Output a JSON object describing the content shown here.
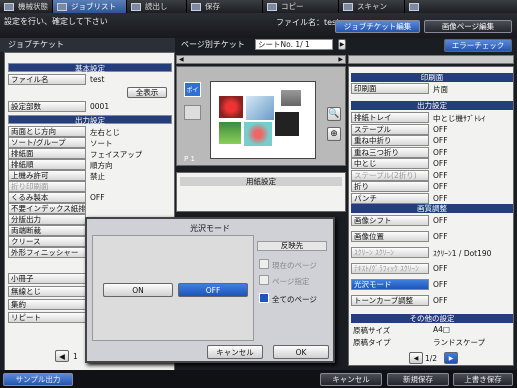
{
  "topbar": {
    "items": [
      {
        "label": "機械状態"
      },
      {
        "label": "ジョブリスト"
      },
      {
        "label": "読出し"
      },
      {
        "label": "保存"
      },
      {
        "label": "コピー"
      },
      {
        "label": "スキャン"
      }
    ]
  },
  "message": "設定を行い、確定して下さい",
  "filename": "ファイル名：test",
  "tabs": {
    "job_ticket_edit": "ジョブチケット編集",
    "page_edit": "画像ページ編集"
  },
  "left": {
    "title": "ジョブチケット",
    "sec_basic": "基本設定",
    "filename_btn": "ファイル名",
    "filename_val": "test",
    "show_all": "全表示",
    "copies_btn": "設定部数",
    "copies_val": "0001",
    "sec_output": "出力設定",
    "rows": [
      {
        "label": "両面とじ方向",
        "val": "左右とじ"
      },
      {
        "label": "ソート/グループ",
        "val": "ソート"
      },
      {
        "label": "排紙面",
        "val": "フェイスアップ"
      },
      {
        "label": "排紙順",
        "val": "順方向"
      },
      {
        "label": "上機み許可",
        "val": "禁止"
      },
      {
        "label": "折り印刷面",
        "val": ""
      },
      {
        "label": "くるみ製本",
        "val": "OFF"
      },
      {
        "label": "不要インデックス紙排紙",
        "val": ""
      },
      {
        "label": "分版出力",
        "val": ""
      },
      {
        "label": "両端断裁",
        "val": ""
      },
      {
        "label": "クリース",
        "val": ""
      },
      {
        "label": "外形フィニッシャー",
        "val": ""
      }
    ],
    "sec_apply": "応用",
    "rows2": [
      {
        "label": "小冊子"
      },
      {
        "label": "無線とじ"
      },
      {
        "label": "集約"
      },
      {
        "label": "リピート"
      }
    ],
    "page_num": "1"
  },
  "middle": {
    "title": "ページ別チケット",
    "sheet": "シートNo.      1/     1",
    "paper_settings": "用紙設定",
    "page_label": "P   1",
    "thumb_label": "ポイ"
  },
  "error_check": "エラーチェック",
  "right": {
    "sec_print_side": "印刷面",
    "print_side_btn": "印刷面",
    "print_side_val": "片面",
    "sec_output": "出力設定",
    "out_rows": [
      {
        "label": "排紙トレイ",
        "val": "中とじ機ｻﾌﾞﾄﾚｲ"
      },
      {
        "label": "ステープル",
        "val": "OFF"
      },
      {
        "label": "重ね中折り",
        "val": "OFF"
      },
      {
        "label": "重ね三つ折り",
        "val": "OFF"
      },
      {
        "label": "中とじ",
        "val": "OFF"
      },
      {
        "label": "ステープル(2折り)",
        "val": "OFF"
      },
      {
        "label": "折り",
        "val": "OFF"
      },
      {
        "label": "パンチ",
        "val": "OFF"
      }
    ],
    "sec_image": "画質調整",
    "img_rows": [
      {
        "label": "画像シフト",
        "val": "OFF"
      },
      {
        "label": "画像位置",
        "val": "OFF"
      },
      {
        "label": "ｽｸﾘｰﾝ ｽｸﾘｰﾝ",
        "val": "ｽｸﾘｰﾝ1 / Dot190"
      },
      {
        "label": "ﾃｷｽﾄ/ｸﾞﾗﾌｨｯｸ ｽｸﾘｰﾝ",
        "val": "OFF"
      },
      {
        "label": "光沢モード",
        "val": "OFF"
      },
      {
        "label": "トーンカーブ調整",
        "val": "OFF"
      }
    ],
    "sec_other": "その他の設定",
    "other_rows": [
      {
        "label": "原稿サイズ",
        "val": "A4□"
      },
      {
        "label": "原稿タイプ",
        "val": "ランドスケープ"
      }
    ],
    "page": "1/2"
  },
  "dialog": {
    "title": "光沢モード",
    "on": "ON",
    "off": "OFF",
    "reflect_title": "反映先",
    "current_page": "現在のページ",
    "page_spec": "ページ指定",
    "all_pages": "全てのページ",
    "cancel": "キャンセル",
    "ok": "OK"
  },
  "bottom": {
    "sample_out": "サンプル出力",
    "cancel": "キャンセル",
    "new_save": "新規保存",
    "overwrite": "上書き保存"
  },
  "colors": {
    "accent": "#1d55b8",
    "header": "#233e7a"
  }
}
